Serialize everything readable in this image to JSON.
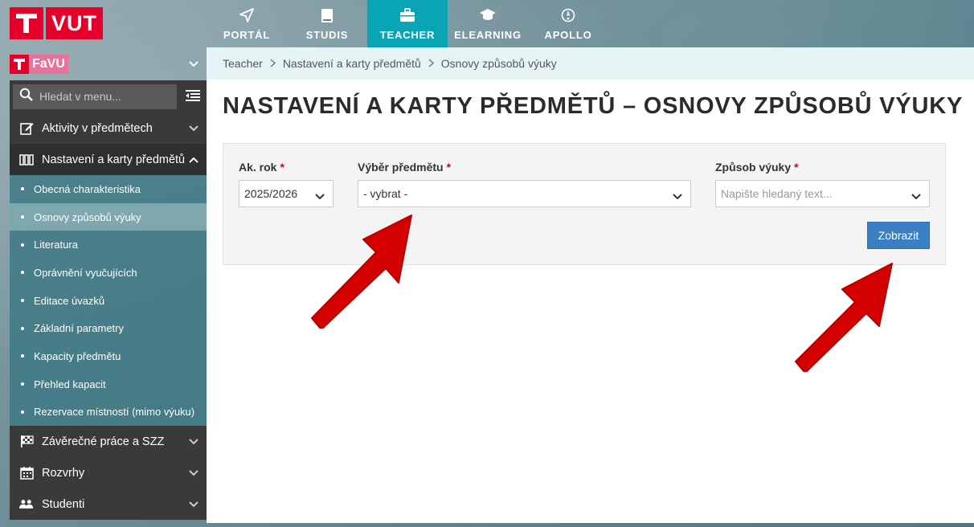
{
  "brand": {
    "logo_text": "VUT",
    "faculty": "FaVU"
  },
  "topnav": [
    {
      "label": "PORTÁL",
      "icon": "navigation-arrow-icon",
      "active": false
    },
    {
      "label": "STUDIS",
      "icon": "book-icon",
      "active": false
    },
    {
      "label": "TEACHER",
      "icon": "briefcase-icon",
      "active": true
    },
    {
      "label": "ELEARNING",
      "icon": "graduation-cap-icon",
      "active": false
    },
    {
      "label": "APOLLO",
      "icon": "rocket-icon",
      "active": false
    }
  ],
  "sidebar": {
    "search_placeholder": "Hledat v menu...",
    "menu": [
      {
        "label": "Aktivity v předmětech",
        "icon": "edit-icon"
      },
      {
        "label": "Nastavení a karty předmětů",
        "icon": "cards-icon"
      },
      {
        "label": "Závěrečné práce a SZZ",
        "icon": "checkered-flag-icon"
      },
      {
        "label": "Rozvrhy",
        "icon": "calendar-icon"
      },
      {
        "label": "Studenti",
        "icon": "users-icon"
      }
    ],
    "submenu": [
      {
        "label": "Obecná charakteristika",
        "active": false
      },
      {
        "label": "Osnovy způsobů výuky",
        "active": true
      },
      {
        "label": "Literatura",
        "active": false
      },
      {
        "label": "Oprávnění vyučujících",
        "active": false
      },
      {
        "label": "Editace úvazků",
        "active": false
      },
      {
        "label": "Základní parametry",
        "active": false
      },
      {
        "label": "Kapacity předmětu",
        "active": false
      },
      {
        "label": "Přehled kapacit",
        "active": false
      },
      {
        "label": "Rezervace místností (mimo výuku)",
        "active": false
      }
    ]
  },
  "breadcrumb": [
    "Teacher",
    "Nastavení a karty předmětů",
    "Osnovy způsobů výuky"
  ],
  "page": {
    "title": "NASTAVENÍ A KARTY PŘEDMĚTŮ – OSNOVY ZPŮSOBŮ VÝUKY",
    "filters": {
      "year_label": "Ak. rok",
      "year_value": "2025/2026",
      "subject_label": "Výběr předmětu",
      "subject_value": "- vybrat -",
      "mode_label": "Způsob výuky",
      "mode_placeholder": "Napište hledaný text...",
      "required_mark": "*"
    },
    "show_button": "Zobrazit"
  },
  "colors": {
    "brand_red": "#e4002b",
    "active_tab": "#0aa5b5",
    "button": "#3a7fc1",
    "annotation_arrow": "#d40000"
  }
}
